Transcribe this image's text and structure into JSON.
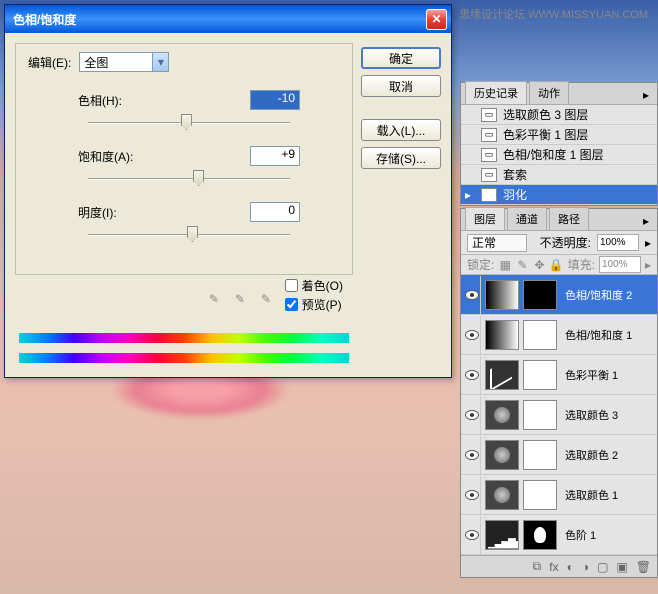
{
  "watermark": "思缘设计论坛  WWW.MISSYUAN.COM",
  "dialog": {
    "title": "色相/饱和度",
    "edit_label": "编辑(E):",
    "edit_value": "全图",
    "hue_label": "色相(H):",
    "hue_value": "-10",
    "sat_label": "饱和度(A):",
    "sat_value": "+9",
    "light_label": "明度(I):",
    "light_value": "0",
    "colorize_label": "着色(O)",
    "preview_label": "预览(P)",
    "buttons": {
      "ok": "确定",
      "cancel": "取消",
      "load": "载入(L)...",
      "save": "存储(S)..."
    }
  },
  "history_panel": {
    "tabs": [
      "历史记录",
      "动作"
    ],
    "items": [
      {
        "label": "选取颜色 3 图层"
      },
      {
        "label": "色彩平衡 1 图层"
      },
      {
        "label": "色相/饱和度 1 图层"
      },
      {
        "label": "套索"
      },
      {
        "label": "羽化",
        "selected": true
      }
    ]
  },
  "layers_panel": {
    "tabs": [
      "图层",
      "通道",
      "路径"
    ],
    "blend_mode": "正常",
    "opacity_label": "不透明度:",
    "opacity_value": "100%",
    "lock_label": "锁定:",
    "fill_label": "填充:",
    "fill_value": "100%",
    "layers": [
      {
        "name": "色相/饱和度 2",
        "type": "gradient",
        "mask": "black",
        "selected": true
      },
      {
        "name": "色相/饱和度 1",
        "type": "gradient",
        "mask": "white"
      },
      {
        "name": "色彩平衡 1",
        "type": "curve",
        "mask": "white"
      },
      {
        "name": "选取颜色 3",
        "type": "circle",
        "mask": "white"
      },
      {
        "name": "选取颜色 2",
        "type": "circle",
        "mask": "white"
      },
      {
        "name": "选取颜色 1",
        "type": "circle",
        "mask": "white"
      },
      {
        "name": "色阶 1",
        "type": "histo",
        "mask": "face"
      }
    ]
  }
}
